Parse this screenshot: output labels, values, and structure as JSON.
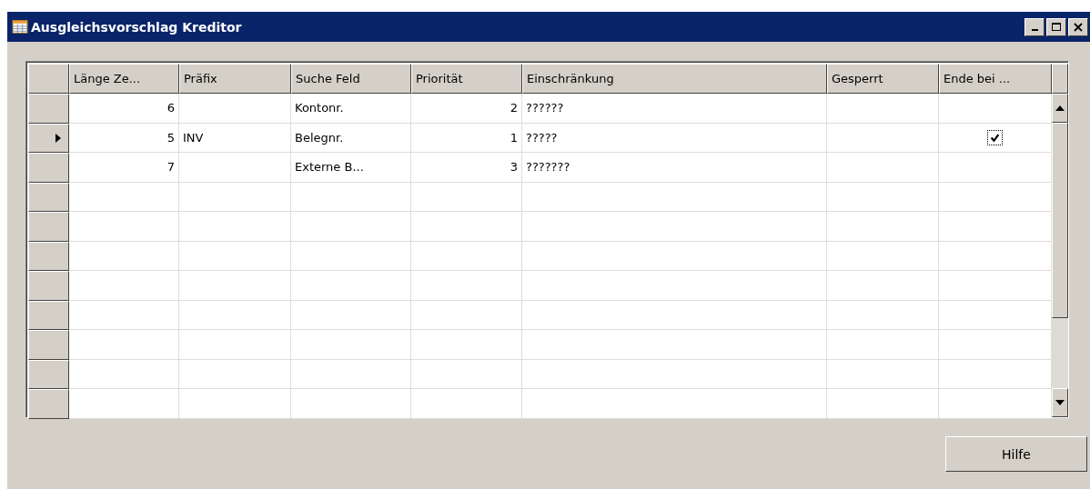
{
  "window": {
    "title": "Ausgleichsvorschlag Kreditor"
  },
  "table": {
    "columns": [
      "Länge Ze...",
      "Präfix",
      "Suche Feld",
      "Priorität",
      "Einschränkung",
      "Gesperrt",
      "Ende bei ..."
    ],
    "rows": [
      {
        "selected": false,
        "length": "6",
        "prefix": "",
        "search_field": "Kontonr.",
        "priority": "2",
        "restriction": "??????",
        "end_checked": false
      },
      {
        "selected": true,
        "length": "5",
        "prefix": "INV",
        "search_field": "Belegnr.",
        "priority": "1",
        "restriction": "?????",
        "end_checked": true
      },
      {
        "selected": false,
        "length": "7",
        "prefix": "",
        "search_field": "Externe B...",
        "priority": "3",
        "restriction": "???????",
        "end_checked": false
      }
    ]
  },
  "buttons": [
    "Hilfe"
  ]
}
